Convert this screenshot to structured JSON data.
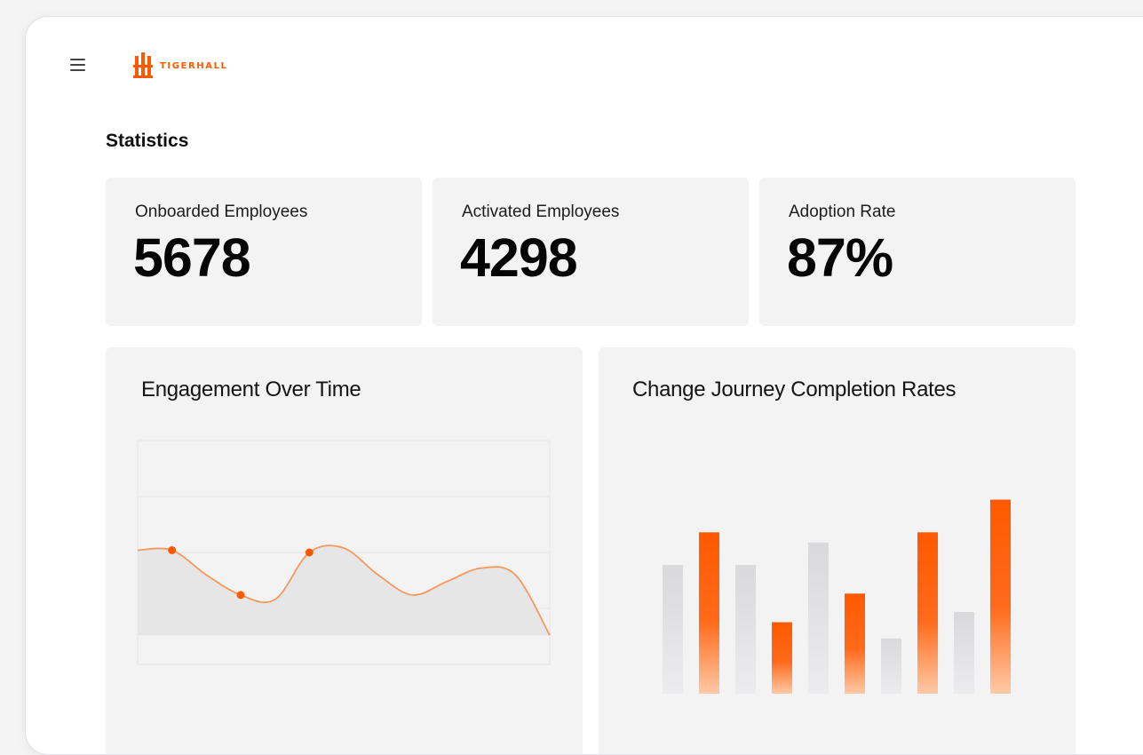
{
  "header": {
    "menu_icon": "hamburger-menu-icon",
    "logo_text": "TIGERHALL",
    "brand_color": "#ff5900"
  },
  "statistics": {
    "title": "Statistics",
    "cards": [
      {
        "label": "Onboarded Employees",
        "value": "5678"
      },
      {
        "label": "Activated Employees",
        "value": "4298"
      },
      {
        "label": "Adoption Rate",
        "value": "87%"
      }
    ]
  },
  "chart_data": [
    {
      "type": "line",
      "title": "Engagement Over Time",
      "color": "#f7995e",
      "marker_color": "#ff5900",
      "fill": "#e4e4e6",
      "grid": true,
      "ylim": [
        0,
        100
      ],
      "x": [
        0,
        1,
        2,
        3,
        4,
        5,
        6,
        7,
        8,
        9,
        10,
        11,
        12
      ],
      "values": [
        51,
        51,
        40,
        31,
        29,
        50,
        52,
        40,
        31,
        37,
        43,
        40,
        13
      ],
      "markers": [
        1,
        3,
        5
      ]
    },
    {
      "type": "bar",
      "title": "Change Journey Completion Rates",
      "ylim": [
        0,
        100
      ],
      "values": [
        63,
        79,
        63,
        35,
        74,
        49,
        27,
        79,
        40,
        95
      ],
      "colors": [
        "#d9d9db",
        "#ff5900",
        "#d9d9db",
        "#ff5900",
        "#d9d9db",
        "#ff5900",
        "#d9d9db",
        "#ff5900",
        "#d9d9db",
        "#ff5900"
      ]
    }
  ]
}
